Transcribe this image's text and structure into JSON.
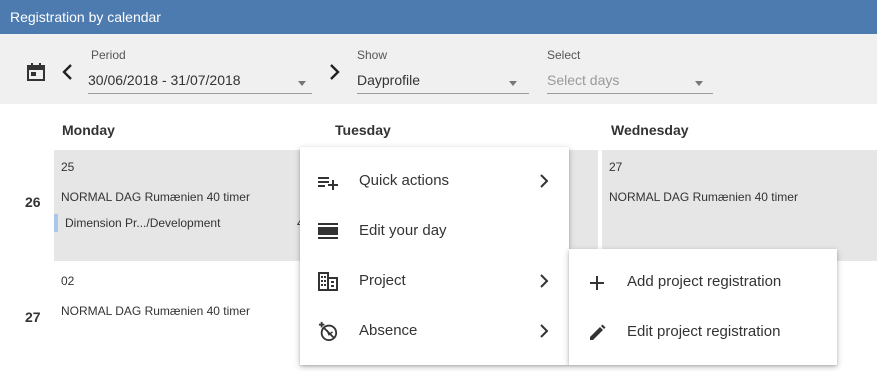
{
  "title": "Registration by calendar",
  "toolbar": {
    "period": {
      "label": "Period",
      "value": "30/06/2018 - 31/07/2018"
    },
    "show": {
      "label": "Show",
      "value": "Dayprofile"
    },
    "select": {
      "label": "Select",
      "placeholder": "Select days"
    }
  },
  "days": {
    "monday": "Monday",
    "tuesday": "Tuesday",
    "wednesday": "Wednesday"
  },
  "weeks": [
    {
      "number": "26",
      "monday": {
        "date": "25",
        "entry": "NORMAL DAG Rumænien 40 timer",
        "registration": "Dimension Pr.../Development",
        "registration_trail": "4"
      },
      "wednesday": {
        "date": "27",
        "entry": "NORMAL DAG Rumænien 40 timer"
      }
    },
    {
      "number": "27",
      "monday": {
        "date": "02",
        "entry": "NORMAL DAG Rumænien 40 timer"
      }
    }
  ],
  "menu": {
    "items": [
      {
        "label": "Quick actions",
        "icon": "playlist-add-icon",
        "has_submenu": true
      },
      {
        "label": "Edit your day",
        "icon": "view-day-icon",
        "has_submenu": false
      },
      {
        "label": "Project",
        "icon": "domain-icon",
        "has_submenu": true
      },
      {
        "label": "Absence",
        "icon": "absence-icon",
        "has_submenu": true
      }
    ]
  },
  "submenu": {
    "items": [
      {
        "label": "Add project registration",
        "icon": "plus-icon"
      },
      {
        "label": "Edit project registration",
        "icon": "pencil-icon"
      }
    ]
  },
  "colors": {
    "header": "#4d7bb0",
    "toolbar": "#f0f0f0",
    "cell": "#e6e6e6",
    "registration_marker": "#a9c7e8"
  }
}
